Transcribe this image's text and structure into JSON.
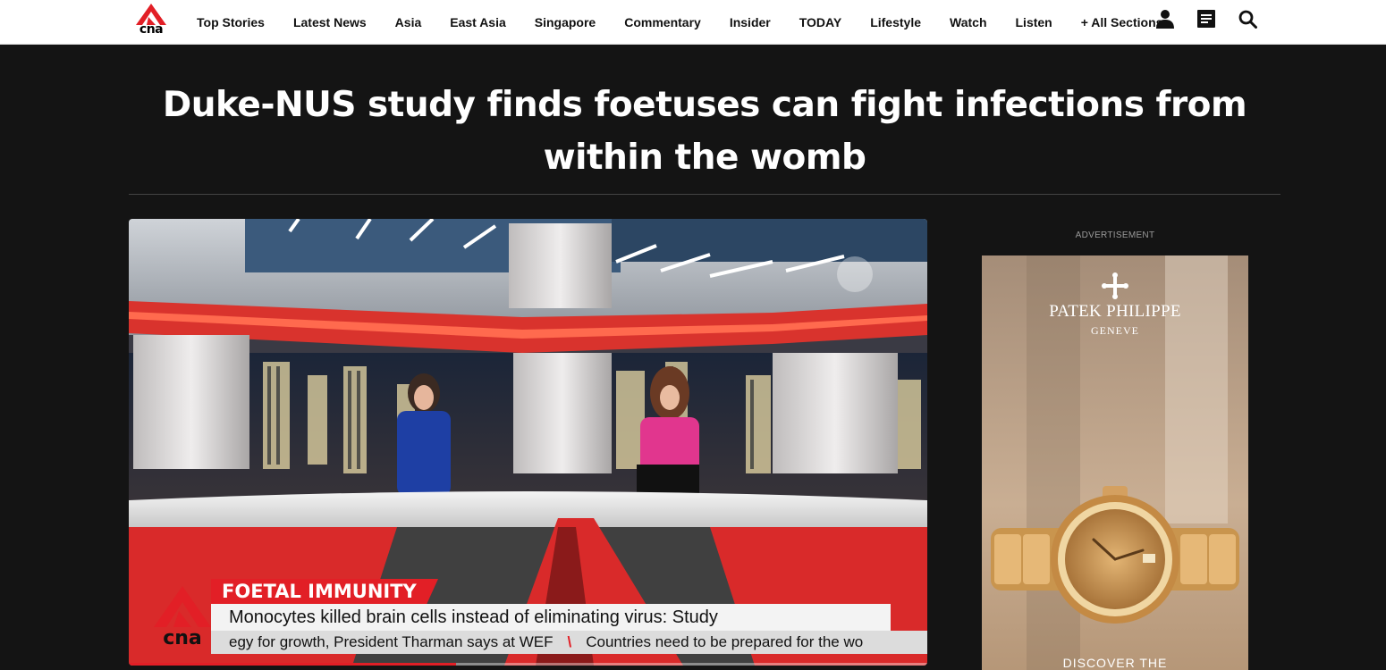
{
  "brand": {
    "logo_text": "cna",
    "accent": "#e21f26"
  },
  "nav": {
    "items": [
      {
        "label": "Top Stories"
      },
      {
        "label": "Latest News"
      },
      {
        "label": "Asia"
      },
      {
        "label": "East Asia"
      },
      {
        "label": "Singapore"
      },
      {
        "label": "Commentary"
      },
      {
        "label": "Insider"
      },
      {
        "label": "TODAY"
      },
      {
        "label": "Lifestyle"
      },
      {
        "label": "Watch"
      },
      {
        "label": "Listen"
      },
      {
        "label": "+ All Sections"
      }
    ],
    "icons": [
      "user-icon",
      "newspaper-icon",
      "search-icon"
    ]
  },
  "article": {
    "title": "Duke-NUS study finds foetuses can fight infections from within the womb"
  },
  "video": {
    "tag": "FOETAL IMMUNITY",
    "caption": "Monocytes killed brain cells instead of eliminating virus: Study",
    "ticker_left": "egy for growth, President Tharman says at WEF",
    "ticker_right": "Countries need to be prepared for the wo",
    "logo_text": "cna",
    "progress": 0.41
  },
  "ad": {
    "label": "ADVERTISEMENT",
    "brand": "PATEK PHILIPPE",
    "sub": "GENEVE",
    "cta": "DISCOVER THE"
  }
}
